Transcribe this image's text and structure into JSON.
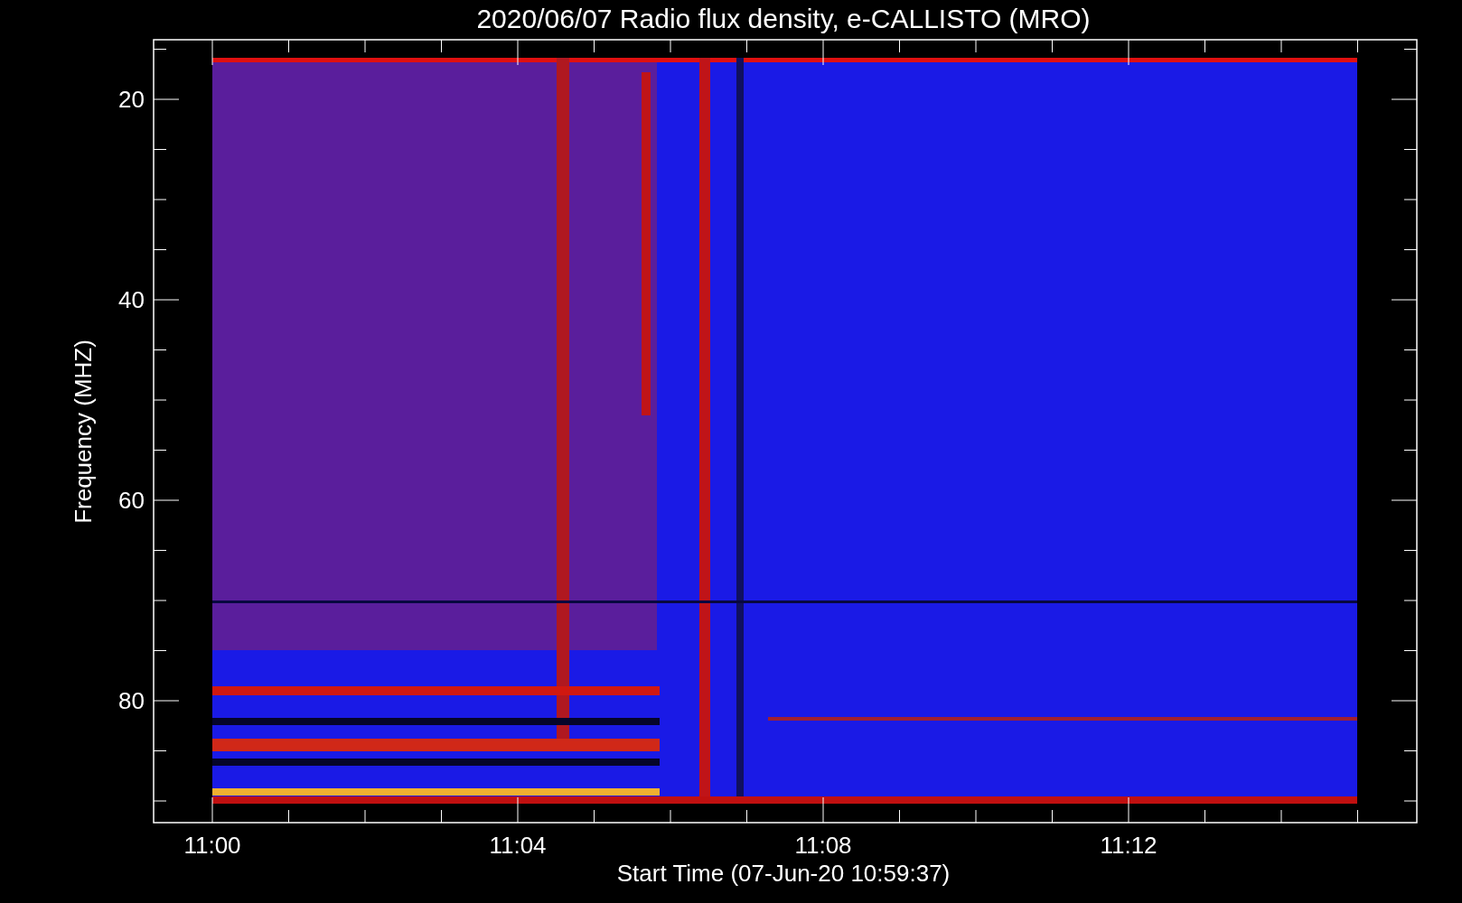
{
  "title": "2020/06/07  Radio flux density, e-CALLISTO (MRO)",
  "y_axis": {
    "label": "Frequency (MHZ)",
    "ticks": [
      "20",
      "40",
      "60",
      "80"
    ]
  },
  "x_axis": {
    "label": "Start Time (07-Jun-20 10:59:37)",
    "ticks": [
      "11:00",
      "11:04",
      "11:08",
      "11:12"
    ]
  }
}
